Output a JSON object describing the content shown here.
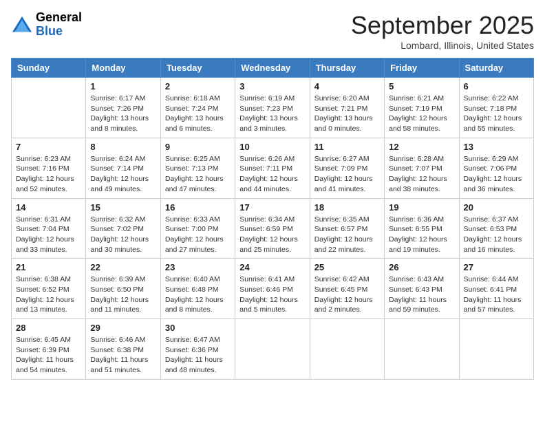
{
  "logo": {
    "general": "General",
    "blue": "Blue"
  },
  "header": {
    "month": "September 2025",
    "location": "Lombard, Illinois, United States"
  },
  "days_of_week": [
    "Sunday",
    "Monday",
    "Tuesday",
    "Wednesday",
    "Thursday",
    "Friday",
    "Saturday"
  ],
  "weeks": [
    [
      {
        "day": "",
        "sunrise": "",
        "sunset": "",
        "daylight": ""
      },
      {
        "day": "1",
        "sunrise": "6:17 AM",
        "sunset": "7:26 PM",
        "daylight": "13 hours and 8 minutes."
      },
      {
        "day": "2",
        "sunrise": "6:18 AM",
        "sunset": "7:24 PM",
        "daylight": "13 hours and 6 minutes."
      },
      {
        "day": "3",
        "sunrise": "6:19 AM",
        "sunset": "7:23 PM",
        "daylight": "13 hours and 3 minutes."
      },
      {
        "day": "4",
        "sunrise": "6:20 AM",
        "sunset": "7:21 PM",
        "daylight": "13 hours and 0 minutes."
      },
      {
        "day": "5",
        "sunrise": "6:21 AM",
        "sunset": "7:19 PM",
        "daylight": "12 hours and 58 minutes."
      },
      {
        "day": "6",
        "sunrise": "6:22 AM",
        "sunset": "7:18 PM",
        "daylight": "12 hours and 55 minutes."
      }
    ],
    [
      {
        "day": "7",
        "sunrise": "6:23 AM",
        "sunset": "7:16 PM",
        "daylight": "12 hours and 52 minutes."
      },
      {
        "day": "8",
        "sunrise": "6:24 AM",
        "sunset": "7:14 PM",
        "daylight": "12 hours and 49 minutes."
      },
      {
        "day": "9",
        "sunrise": "6:25 AM",
        "sunset": "7:13 PM",
        "daylight": "12 hours and 47 minutes."
      },
      {
        "day": "10",
        "sunrise": "6:26 AM",
        "sunset": "7:11 PM",
        "daylight": "12 hours and 44 minutes."
      },
      {
        "day": "11",
        "sunrise": "6:27 AM",
        "sunset": "7:09 PM",
        "daylight": "12 hours and 41 minutes."
      },
      {
        "day": "12",
        "sunrise": "6:28 AM",
        "sunset": "7:07 PM",
        "daylight": "12 hours and 38 minutes."
      },
      {
        "day": "13",
        "sunrise": "6:29 AM",
        "sunset": "7:06 PM",
        "daylight": "12 hours and 36 minutes."
      }
    ],
    [
      {
        "day": "14",
        "sunrise": "6:31 AM",
        "sunset": "7:04 PM",
        "daylight": "12 hours and 33 minutes."
      },
      {
        "day": "15",
        "sunrise": "6:32 AM",
        "sunset": "7:02 PM",
        "daylight": "12 hours and 30 minutes."
      },
      {
        "day": "16",
        "sunrise": "6:33 AM",
        "sunset": "7:00 PM",
        "daylight": "12 hours and 27 minutes."
      },
      {
        "day": "17",
        "sunrise": "6:34 AM",
        "sunset": "6:59 PM",
        "daylight": "12 hours and 25 minutes."
      },
      {
        "day": "18",
        "sunrise": "6:35 AM",
        "sunset": "6:57 PM",
        "daylight": "12 hours and 22 minutes."
      },
      {
        "day": "19",
        "sunrise": "6:36 AM",
        "sunset": "6:55 PM",
        "daylight": "12 hours and 19 minutes."
      },
      {
        "day": "20",
        "sunrise": "6:37 AM",
        "sunset": "6:53 PM",
        "daylight": "12 hours and 16 minutes."
      }
    ],
    [
      {
        "day": "21",
        "sunrise": "6:38 AM",
        "sunset": "6:52 PM",
        "daylight": "12 hours and 13 minutes."
      },
      {
        "day": "22",
        "sunrise": "6:39 AM",
        "sunset": "6:50 PM",
        "daylight": "12 hours and 11 minutes."
      },
      {
        "day": "23",
        "sunrise": "6:40 AM",
        "sunset": "6:48 PM",
        "daylight": "12 hours and 8 minutes."
      },
      {
        "day": "24",
        "sunrise": "6:41 AM",
        "sunset": "6:46 PM",
        "daylight": "12 hours and 5 minutes."
      },
      {
        "day": "25",
        "sunrise": "6:42 AM",
        "sunset": "6:45 PM",
        "daylight": "12 hours and 2 minutes."
      },
      {
        "day": "26",
        "sunrise": "6:43 AM",
        "sunset": "6:43 PM",
        "daylight": "11 hours and 59 minutes."
      },
      {
        "day": "27",
        "sunrise": "6:44 AM",
        "sunset": "6:41 PM",
        "daylight": "11 hours and 57 minutes."
      }
    ],
    [
      {
        "day": "28",
        "sunrise": "6:45 AM",
        "sunset": "6:39 PM",
        "daylight": "11 hours and 54 minutes."
      },
      {
        "day": "29",
        "sunrise": "6:46 AM",
        "sunset": "6:38 PM",
        "daylight": "11 hours and 51 minutes."
      },
      {
        "day": "30",
        "sunrise": "6:47 AM",
        "sunset": "6:36 PM",
        "daylight": "11 hours and 48 minutes."
      },
      {
        "day": "",
        "sunrise": "",
        "sunset": "",
        "daylight": ""
      },
      {
        "day": "",
        "sunrise": "",
        "sunset": "",
        "daylight": ""
      },
      {
        "day": "",
        "sunrise": "",
        "sunset": "",
        "daylight": ""
      },
      {
        "day": "",
        "sunrise": "",
        "sunset": "",
        "daylight": ""
      }
    ]
  ],
  "labels": {
    "sunrise_prefix": "Sunrise: ",
    "sunset_prefix": "Sunset: ",
    "daylight_prefix": "Daylight: "
  }
}
